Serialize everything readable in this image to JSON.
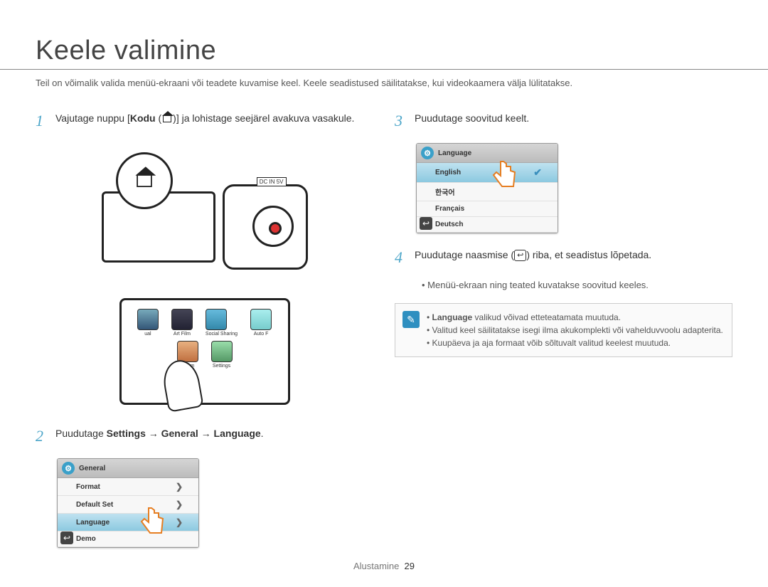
{
  "title": "Keele valimine",
  "intro": "Teil on võimalik valida menüü-ekraani või teadete kuvamise keel. Keele seadistused säilitatakse, kui videokaamera välja lülitatakse.",
  "steps": {
    "s1": {
      "num": "1",
      "pre": "Vajutage nuppu [",
      "kodu": "Kodu",
      "post": ")] ja lohistage seejärel avakuva vasakule."
    },
    "s2": {
      "num": "2",
      "pre": "Puudutage ",
      "path": "Settings → General → Language",
      "post": "."
    },
    "s3": {
      "num": "3",
      "text": "Puudutage soovitud keelt."
    },
    "s4": {
      "num": "4",
      "pre": "Puudutage naasmise (",
      "post": ") riba, et seadistus lõpetada.",
      "bullet": "Menüü-ekraan ning teated kuvatakse soovitud keeles."
    }
  },
  "settings_panel": {
    "header": "General",
    "rows": [
      "Format",
      "Default Set",
      "Language",
      "Demo"
    ]
  },
  "language_panel": {
    "header": "Language",
    "rows": [
      "English",
      "한국어",
      "Français",
      "Deutsch"
    ]
  },
  "home_icons": {
    "row1": [
      "ual",
      "Art Film",
      "Social Sharing",
      "Auto F"
    ],
    "row2": [
      "Album",
      "Settings"
    ]
  },
  "note": {
    "lang_word": "Language",
    "items": [
      " valikud võivad etteteatamata muutuda.",
      "Valitud keel säilitatakse isegi ilma akukomplekti või vahelduvvoolu adapterita.",
      "Kuupäeva ja aja formaat võib sõltuvalt valitud keelest muutuda."
    ]
  },
  "footer": {
    "section": "Alustamine",
    "page": "29"
  }
}
